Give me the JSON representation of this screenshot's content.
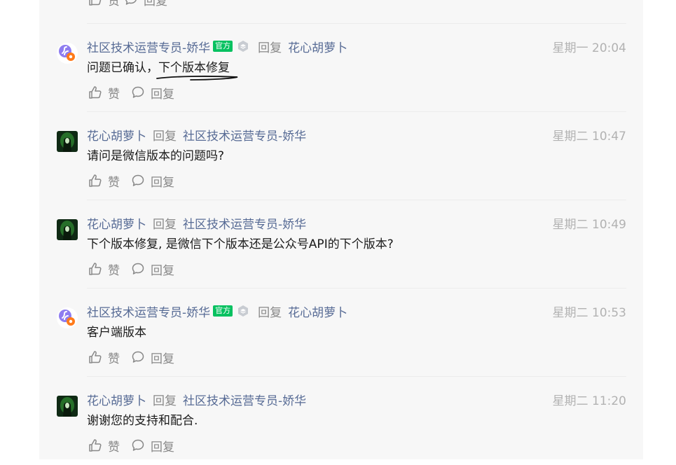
{
  "actions": {
    "like_label": "赞",
    "reply_label": "回复"
  },
  "reply_word": "回复",
  "comments": [
    {
      "author": "社区技术运营专员-娇华",
      "official_badge": "官方",
      "reply_to": "花心胡萝卜",
      "time": "星期一 20:04",
      "text_prefix": "问题已确认，",
      "text_highlight": "下个版本修复",
      "avatar": "official-logo-icon"
    },
    {
      "author": "花心胡萝卜",
      "reply_to": "社区技术运营专员-娇华",
      "time": "星期二 10:47",
      "text": "请问是微信版本的问题吗?",
      "avatar": "dark-figure-avatar"
    },
    {
      "author": "花心胡萝卜",
      "reply_to": "社区技术运营专员-娇华",
      "time": "星期二 10:49",
      "text": "下个版本修复, 是微信下个版本还是公众号API的下个版本?",
      "avatar": "dark-figure-avatar"
    },
    {
      "author": "社区技术运营专员-娇华",
      "official_badge": "官方",
      "reply_to": "花心胡萝卜",
      "time": "星期二 10:53",
      "text": "客户端版本",
      "avatar": "official-logo-icon"
    },
    {
      "author": "花心胡萝卜",
      "reply_to": "社区技术运营专员-娇华",
      "time": "星期二 11:20",
      "text": "谢谢您的支持和配合.",
      "avatar": "dark-figure-avatar"
    }
  ],
  "colors": {
    "name_link": "#576b95",
    "official_green": "#07c160",
    "meta_gray": "#888888",
    "time_gray": "#b2b2b2",
    "panel_bg": "#f7f7f7"
  }
}
